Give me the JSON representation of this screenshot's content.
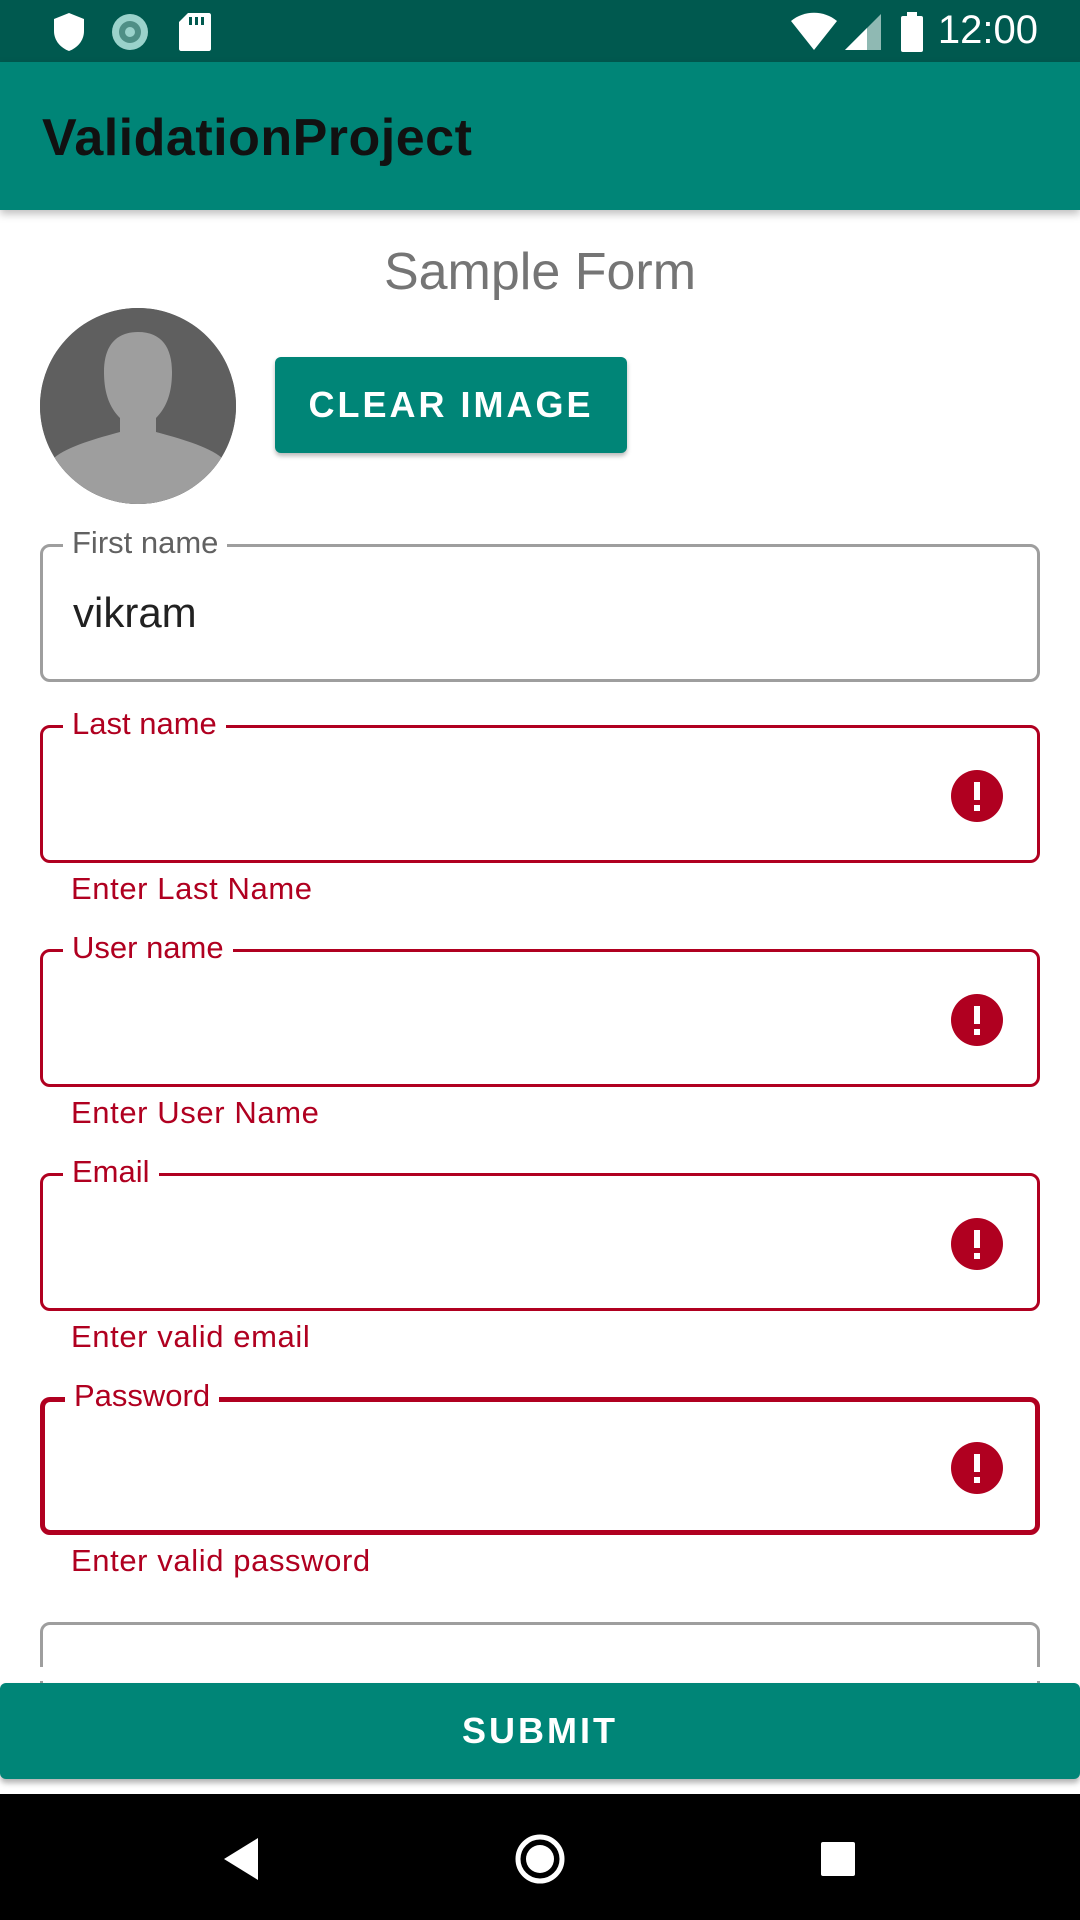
{
  "status_bar": {
    "time": "12:00",
    "icons": [
      "shield-icon",
      "sync-icon",
      "sd-card-icon",
      "wifi-icon",
      "signal-icon",
      "battery-icon"
    ]
  },
  "app_bar": {
    "title": "ValidationProject"
  },
  "form": {
    "title": "Sample Form",
    "clear_image_label": "CLEAR IMAGE",
    "fields": [
      {
        "label": "First name",
        "value": "vikram",
        "error": ""
      },
      {
        "label": "Last name",
        "value": "",
        "error": "Enter Last Name"
      },
      {
        "label": "User name",
        "value": "",
        "error": "Enter User Name"
      },
      {
        "label": "Email",
        "value": "",
        "error": "Enter valid email"
      },
      {
        "label": "Password",
        "value": "",
        "error": "Enter valid password"
      }
    ],
    "submit_label": "SUBMIT"
  },
  "colors": {
    "primary": "#008577",
    "primary_dark": "#00594f",
    "error": "#b00020",
    "outline": "#9e9e9e"
  },
  "nav_bar": {
    "icons": [
      "back-icon",
      "home-icon",
      "recents-icon"
    ]
  }
}
